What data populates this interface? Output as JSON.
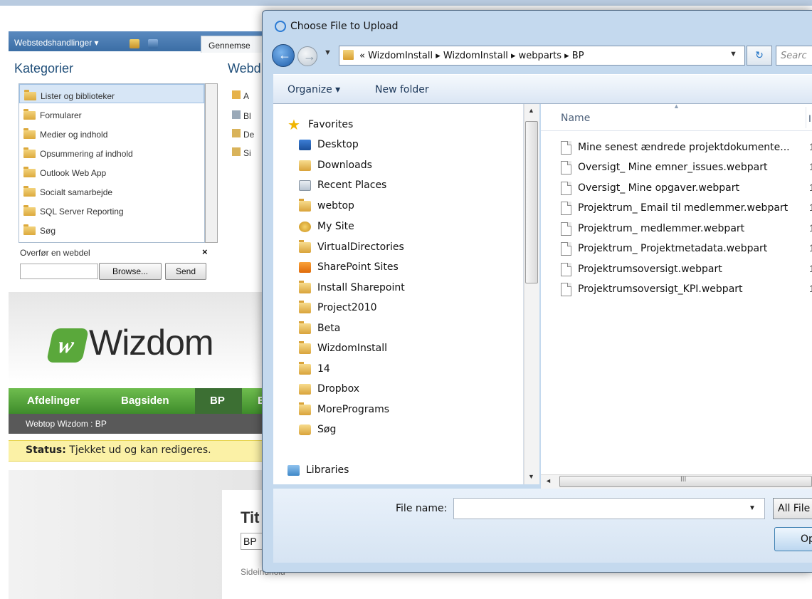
{
  "sharepoint": {
    "site_actions": "Webstedshandlinger",
    "browse_tab": "Gennemse",
    "categories_title": "Kategorier",
    "webparts_title": "Webd",
    "categories": [
      "Lister og biblioteker",
      "Formularer",
      "Medier og indhold",
      "Opsummering af indhold",
      "Outlook Web App",
      "Socialt samarbejde",
      "SQL Server Reporting",
      "Søg"
    ],
    "webpart_items": [
      "A",
      "Bl",
      "De",
      "Si"
    ],
    "upload_title": "Overfør en webdel",
    "upload_close": "×",
    "browse_button": "Browse...",
    "send_button": "Send",
    "logo_mark": "w",
    "logo_text": "Wizdom",
    "nav": [
      "Afdelinger",
      "Bagsiden",
      "BP",
      "E"
    ],
    "breadcrumb": "Webtop Wizdom : BP",
    "status_label": "Status:",
    "status_text": "Tjekket ud og kan redigeres.",
    "title_fragment": "Tit",
    "bp_field_value": "BP",
    "page_content_label": "Sideindhold"
  },
  "dialog": {
    "title": "Choose File to Upload",
    "address": "« WizdomInstall ▸ WizdomInstall ▸ webparts ▸ BP",
    "search_placeholder": "Searc",
    "organize": "Organize ▾",
    "new_folder": "New folder",
    "nav_items": [
      {
        "label": "Favorites",
        "icon": "star-icon"
      },
      {
        "label": "Desktop",
        "icon": "desktop-icon"
      },
      {
        "label": "Downloads",
        "icon": "downloads-icon"
      },
      {
        "label": "Recent Places",
        "icon": "recent-places-icon"
      },
      {
        "label": "webtop",
        "icon": "folder-icon"
      },
      {
        "label": "My Site",
        "icon": "my-site-icon"
      },
      {
        "label": "VirtualDirectories",
        "icon": "folder-icon"
      },
      {
        "label": "SharePoint Sites",
        "icon": "sharepoint-icon"
      },
      {
        "label": "Install Sharepoint",
        "icon": "folder-icon"
      },
      {
        "label": "Project2010",
        "icon": "folder-icon"
      },
      {
        "label": "Beta",
        "icon": "folder-icon"
      },
      {
        "label": "WizdomInstall",
        "icon": "folder-icon"
      },
      {
        "label": "14",
        "icon": "folder-icon"
      },
      {
        "label": "Dropbox",
        "icon": "dropbox-icon"
      },
      {
        "label": "MorePrograms",
        "icon": "folder-icon"
      },
      {
        "label": "Søg",
        "icon": "search-folder-icon"
      },
      {
        "label": "Libraries",
        "icon": "libraries-icon"
      }
    ],
    "column_name": "Name",
    "column_next": "I",
    "files": [
      {
        "name": "Mine senest ændrede projektdokumente...",
        "date": "1"
      },
      {
        "name": "Oversigt_ Mine emner_issues.webpart",
        "date": "1"
      },
      {
        "name": "Oversigt_ Mine opgaver.webpart",
        "date": "1"
      },
      {
        "name": "Projektrum_ Email til medlemmer.webpart",
        "date": "1"
      },
      {
        "name": "Projektrum_ medlemmer.webpart",
        "date": "1"
      },
      {
        "name": "Projektrum_ Projektmetadata.webpart",
        "date": "1"
      },
      {
        "name": "Projektrumsoversigt.webpart",
        "date": "1"
      },
      {
        "name": "Projektrumsoversigt_KPI.webpart",
        "date": "1"
      }
    ],
    "file_name_label": "File name:",
    "file_name_value": "",
    "filter": "All File",
    "open_button": "Op"
  }
}
